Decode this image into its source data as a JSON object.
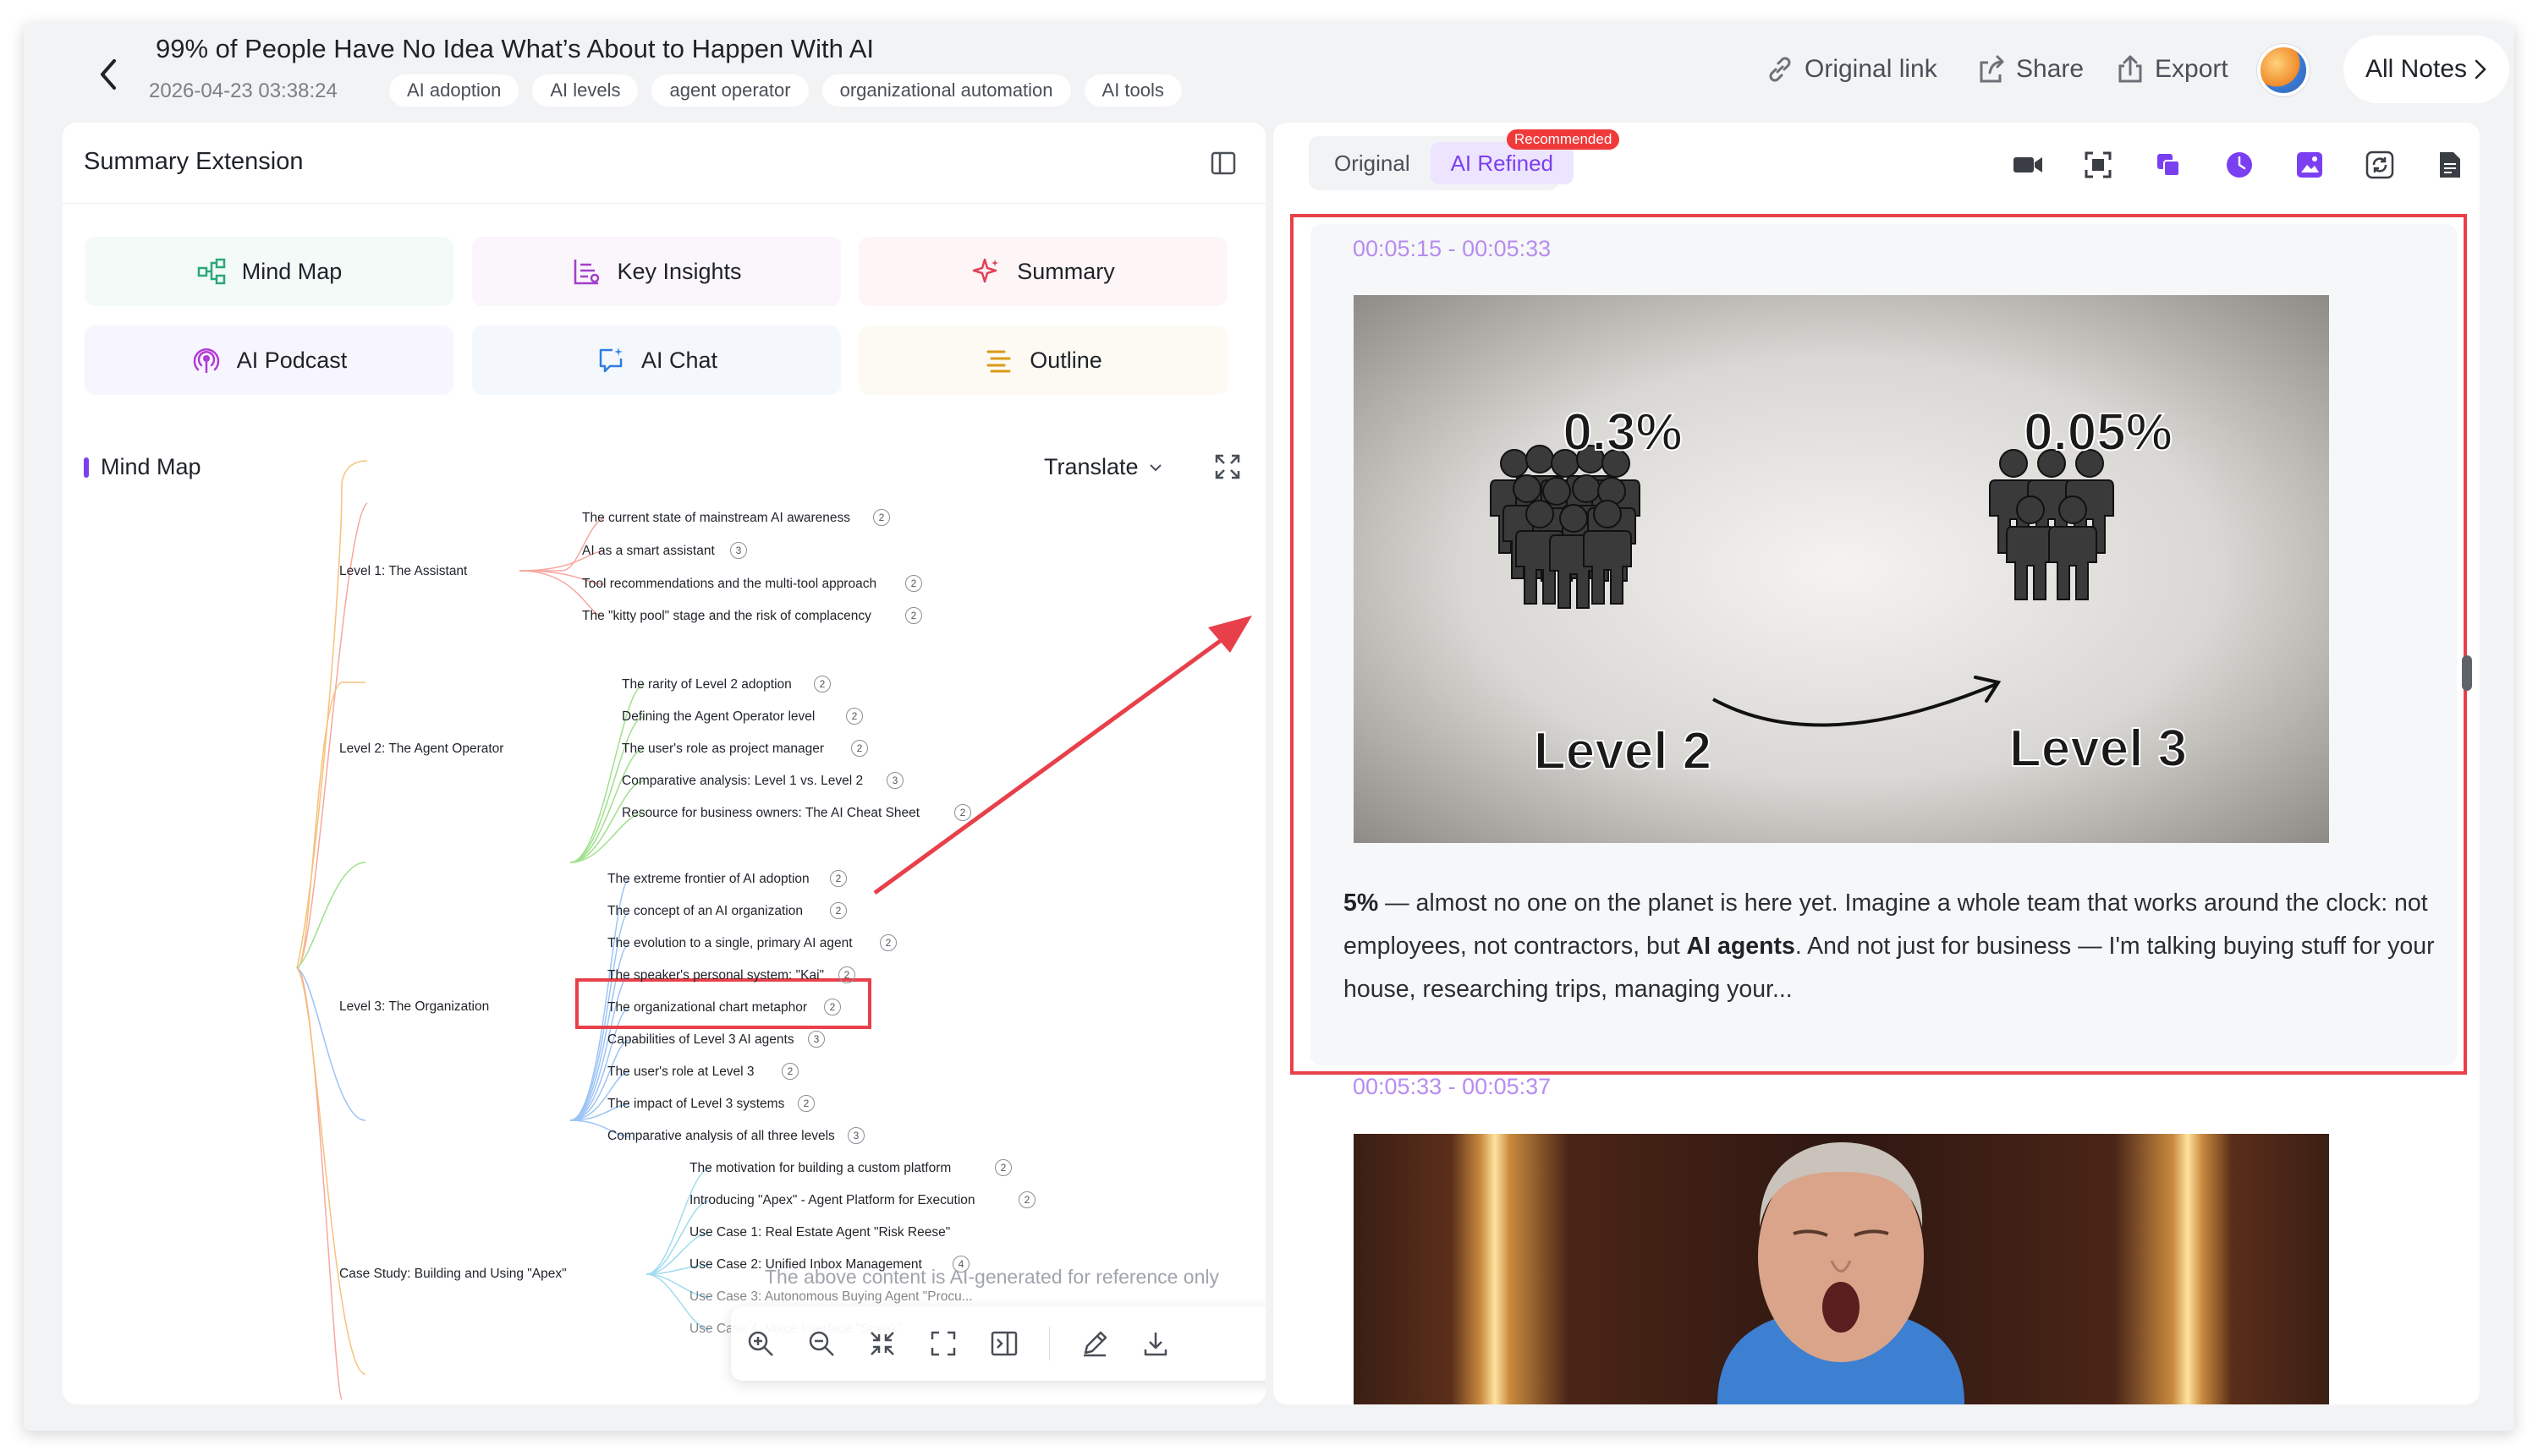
{
  "header": {
    "title": "99% of People Have No Idea What’s About to Happen With AI",
    "date": "2026-04-23 03:38:24",
    "tags": [
      "AI adoption",
      "AI levels",
      "agent operator",
      "organizational automation",
      "AI tools"
    ],
    "actions": {
      "original_link": "Original link",
      "share": "Share",
      "export": "Export"
    },
    "all_notes": "All Notes"
  },
  "left_panel": {
    "title": "Summary Extension",
    "cards": [
      {
        "label": "Mind Map",
        "icon": "mind-map-icon"
      },
      {
        "label": "Key Insights",
        "icon": "key-insights-icon"
      },
      {
        "label": "Summary",
        "icon": "sparkle-icon"
      },
      {
        "label": "AI Podcast",
        "icon": "podcast-icon"
      },
      {
        "label": "AI Chat",
        "icon": "chat-icon"
      },
      {
        "label": "Outline",
        "icon": "outline-icon"
      }
    ],
    "section_label": "Mind Map",
    "translate": "Translate",
    "mindmap": {
      "branches": [
        {
          "label": "Level 1: The Assistant",
          "children": [
            {
              "label": "The current state of mainstream AI awareness",
              "count": "2"
            },
            {
              "label": "AI as a smart assistant",
              "count": "3"
            },
            {
              "label": "Tool recommendations and the multi-tool approach",
              "count": "2"
            },
            {
              "label": "The \"kitty pool\" stage and the risk of complacency",
              "count": "2"
            }
          ]
        },
        {
          "label": "Level 2: The Agent Operator",
          "children": [
            {
              "label": "The rarity of Level 2 adoption",
              "count": "2"
            },
            {
              "label": "Defining the Agent Operator level",
              "count": "2"
            },
            {
              "label": "The user's role as project manager",
              "count": "2"
            },
            {
              "label": "Comparative analysis: Level 1 vs. Level 2",
              "count": "3"
            },
            {
              "label": "Resource for business owners: The AI Cheat Sheet",
              "count": "2"
            }
          ]
        },
        {
          "label": "Level 3: The Organization",
          "children": [
            {
              "label": "The extreme frontier of AI adoption",
              "count": "2"
            },
            {
              "label": "The concept of an AI organization",
              "count": "2"
            },
            {
              "label": "The evolution to a single, primary AI agent",
              "count": "2"
            },
            {
              "label": "The speaker's personal system: \"Kai\"",
              "count": "2"
            },
            {
              "label": "The organizational chart metaphor",
              "count": "2"
            },
            {
              "label": "Capabilities of Level 3 AI agents",
              "count": "3"
            },
            {
              "label": "The user's role at Level 3",
              "count": "2"
            },
            {
              "label": "The impact of Level 3 systems",
              "count": "2"
            },
            {
              "label": "Comparative analysis of all three levels",
              "count": "3"
            }
          ]
        },
        {
          "label": "Case Study: Building and Using \"Apex\"",
          "children": [
            {
              "label": "The motivation for building a custom platform",
              "count": "2"
            },
            {
              "label": "Introducing \"Apex\" - Agent Platform for Execution",
              "count": "2"
            },
            {
              "label": "Use Case 1: Real Estate Agent \"Risk Reese\"",
              "count": "2"
            },
            {
              "label": "Use Case 2: Unified Inbox Management",
              "count": "4"
            },
            {
              "label": "Use Case 3: Autonomous Buying Agent \"Procu...",
              "count": "2"
            },
            {
              "label": "Use Case 4: Voice Interface \"Speak\"",
              "count": ""
            }
          ]
        }
      ]
    },
    "disclaimer": "The above content is AI-generated for reference only"
  },
  "right_panel": {
    "tabs": {
      "original": "Original",
      "refined": "AI Refined",
      "badge": "Recommended"
    },
    "segment1": {
      "timestamp": "00:05:15 - 00:05:33",
      "slide": {
        "left_pct": "0.3%",
        "left_level": "Level 2",
        "right_pct": "0.05%",
        "right_level": "Level 3"
      },
      "text_bold_1": "5%",
      "text_1": " — almost no one on the planet is here yet. Imagine a whole team that works around the clock: not employees, not contractors, but ",
      "text_bold_2": "AI agents",
      "text_2": ". And not just for business — I'm talking buying stuff for your house, researching trips, managing your..."
    },
    "segment2": {
      "timestamp": "00:05:33 - 00:05:37"
    }
  },
  "colors": {
    "accent": "#7b3ff2",
    "highlight_border": "#e8404a",
    "timestamp": "#b78cf0",
    "badge": "#f03a3a"
  }
}
